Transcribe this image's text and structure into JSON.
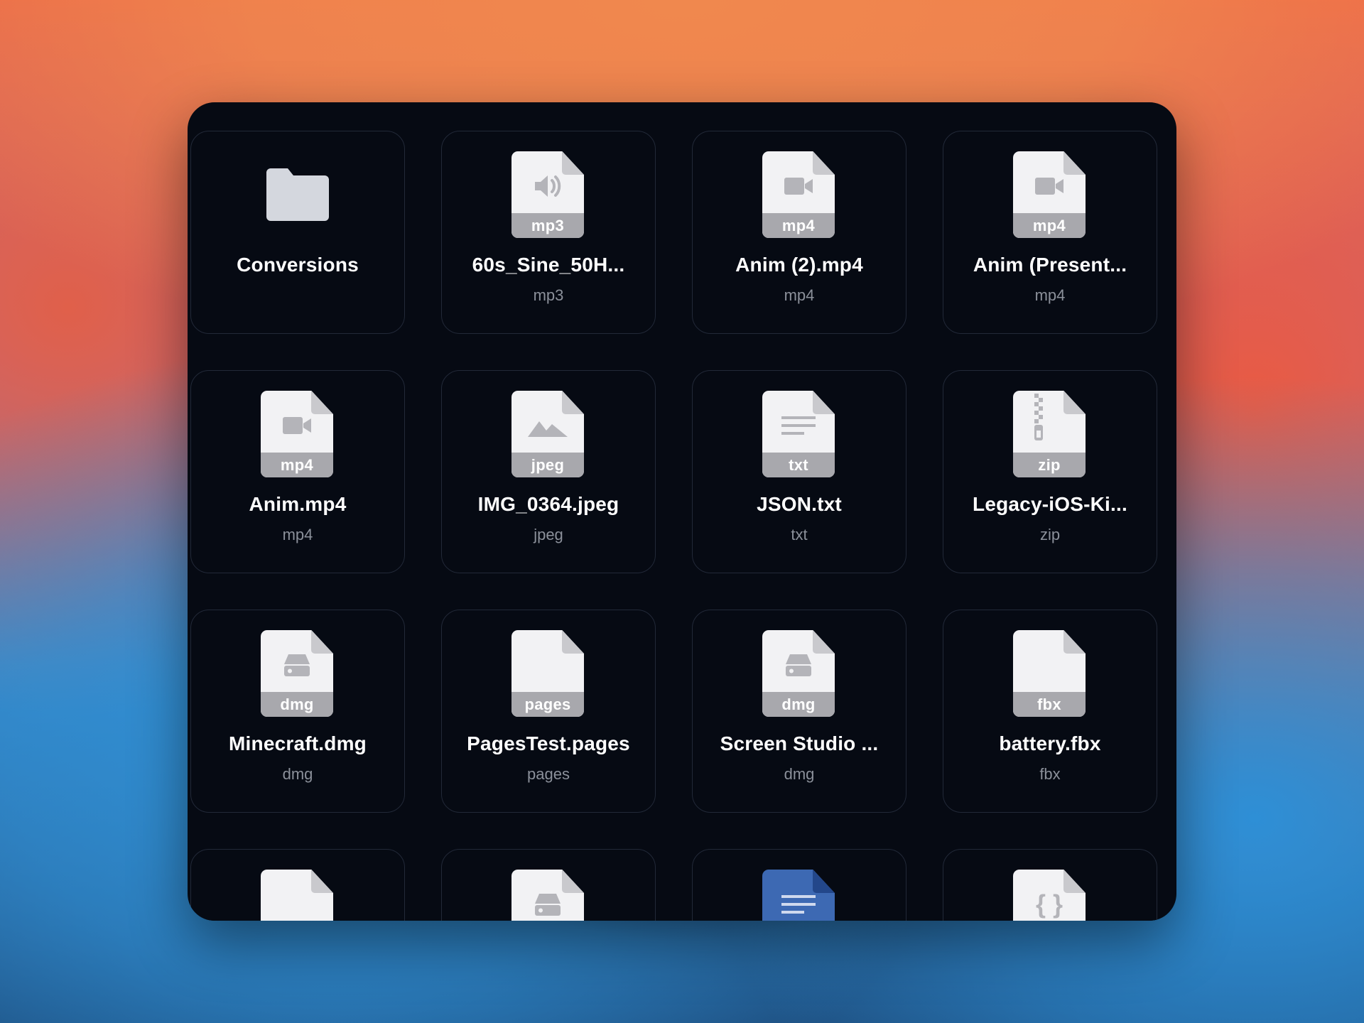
{
  "files": [
    {
      "name": "Conversions",
      "ext": "",
      "badge": "",
      "kind": "folder",
      "glyph": "folder-icon"
    },
    {
      "name": "60s_Sine_50H...",
      "ext": "mp3",
      "badge": "mp3",
      "kind": "file",
      "glyph": "speaker-icon"
    },
    {
      "name": "Anim (2).mp4",
      "ext": "mp4",
      "badge": "mp4",
      "kind": "file",
      "glyph": "video-camera-icon"
    },
    {
      "name": "Anim (Present...",
      "ext": "mp4",
      "badge": "mp4",
      "kind": "file",
      "glyph": "video-camera-icon"
    },
    {
      "name": "Anim.mp4",
      "ext": "mp4",
      "badge": "mp4",
      "kind": "file",
      "glyph": "video-camera-icon"
    },
    {
      "name": "IMG_0364.jpeg",
      "ext": "jpeg",
      "badge": "jpeg",
      "kind": "file",
      "glyph": "image-mountain-icon"
    },
    {
      "name": "JSON.txt",
      "ext": "txt",
      "badge": "txt",
      "kind": "file",
      "glyph": "text-lines-icon"
    },
    {
      "name": "Legacy-iOS-Ki...",
      "ext": "zip",
      "badge": "zip",
      "kind": "file",
      "glyph": "zipper-icon"
    },
    {
      "name": "Minecraft.dmg",
      "ext": "dmg",
      "badge": "dmg",
      "kind": "file",
      "glyph": "disk-drive-icon"
    },
    {
      "name": "PagesTest.pages",
      "ext": "pages",
      "badge": "pages",
      "kind": "file",
      "glyph": "none"
    },
    {
      "name": "Screen Studio ...",
      "ext": "dmg",
      "badge": "dmg",
      "kind": "file",
      "glyph": "disk-drive-icon"
    },
    {
      "name": "battery.fbx",
      "ext": "fbx",
      "badge": "fbx",
      "kind": "file",
      "glyph": "none"
    },
    {
      "name": "",
      "ext": "",
      "badge": "",
      "kind": "file",
      "glyph": "none"
    },
    {
      "name": "",
      "ext": "",
      "badge": "",
      "kind": "file",
      "glyph": "disk-drive-icon"
    },
    {
      "name": "",
      "ext": "",
      "badge": "",
      "kind": "file-blue",
      "glyph": "text-lines-icon"
    },
    {
      "name": "",
      "ext": "",
      "badge": "",
      "kind": "file",
      "glyph": "braces-icon"
    }
  ],
  "colors": {
    "panel": "#060a13",
    "tile_border": "#222938",
    "doc": "#f2f2f4",
    "doc_band": "#a8a8ad",
    "doc_blue": "#3d69b3",
    "folder": "#d4d7de",
    "text_primary": "#ffffff",
    "text_secondary": "#8b909a"
  }
}
